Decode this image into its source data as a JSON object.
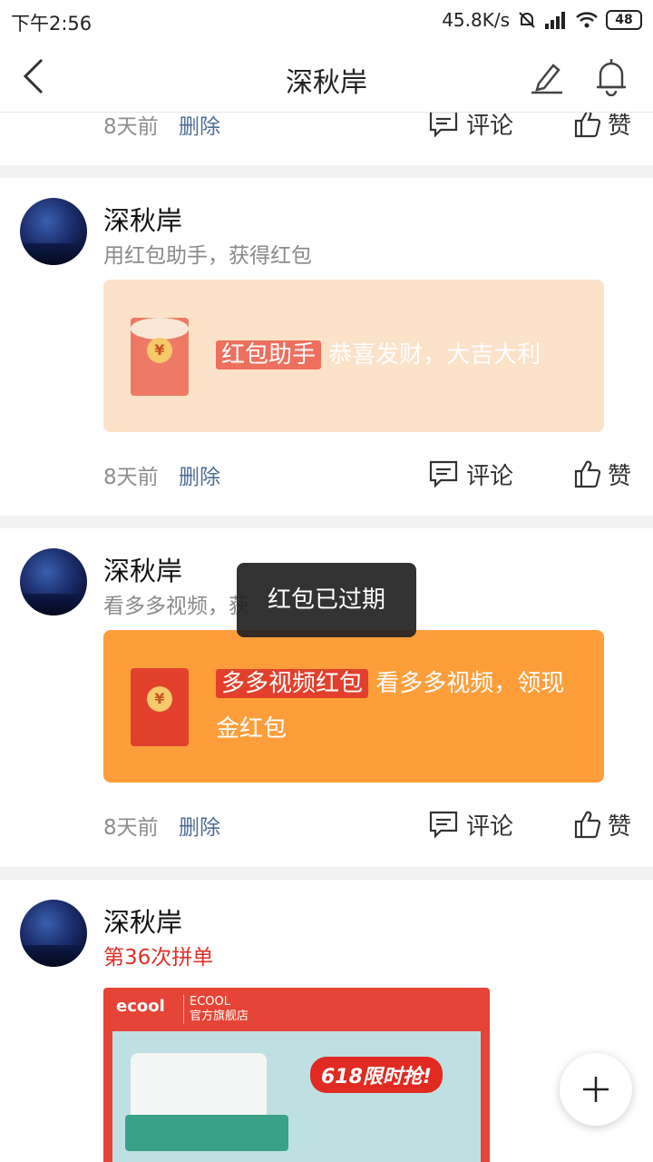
{
  "status_bar": {
    "time": "下午2:56",
    "speed": "45.8K/s",
    "battery": "48"
  },
  "nav": {
    "title": "深秋岸"
  },
  "top_action": {
    "time": "8天前",
    "delete": "删除",
    "comment": "评论",
    "like": "赞"
  },
  "posts": [
    {
      "author": "深秋岸",
      "desc": "用红包助手，获得红包",
      "card": {
        "tag": "红包助手",
        "text": "恭喜发财，大吉大利"
      },
      "time": "8天前",
      "delete": "删除",
      "comment": "评论",
      "like": "赞"
    },
    {
      "author": "深秋岸",
      "desc": "看多多视频，获",
      "card": {
        "tag": "多多视频红包",
        "text": "看多多视频，领现金红包"
      },
      "time": "8天前",
      "delete": "删除",
      "comment": "评论",
      "like": "赞"
    },
    {
      "author": "深秋岸",
      "desc": "第36次拼单",
      "product": {
        "brand": "ecool",
        "brand_sub1": "ECOOL",
        "brand_sub2": "官方旗舰店",
        "promo": "618限时抢!"
      }
    }
  ],
  "toast": "红包已过期",
  "coin_symbol": "¥",
  "colors": {
    "accent_red": "#e0302a",
    "card_light": "#fce2c8",
    "card_orange": "#fe9e3a"
  }
}
